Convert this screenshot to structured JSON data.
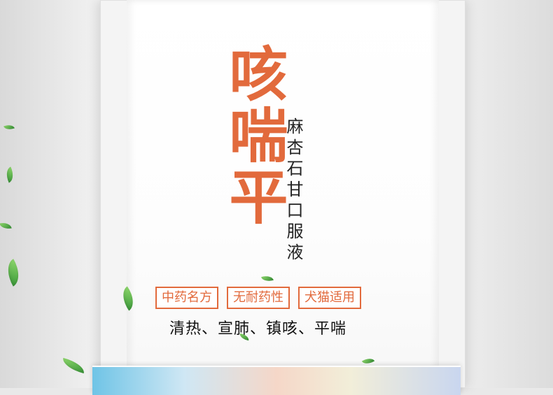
{
  "colors": {
    "accent": "#e26a3c"
  },
  "product": {
    "title": "咳喘平",
    "subtitle": "麻杏石甘口服液"
  },
  "tags": [
    "中药名方",
    "无耐药性",
    "犬猫适用"
  ],
  "effects": "清热、宣肺、镇咳、平喘",
  "decor": {
    "leaf_icon": "leaf-icon",
    "package_icon": "product-box"
  }
}
